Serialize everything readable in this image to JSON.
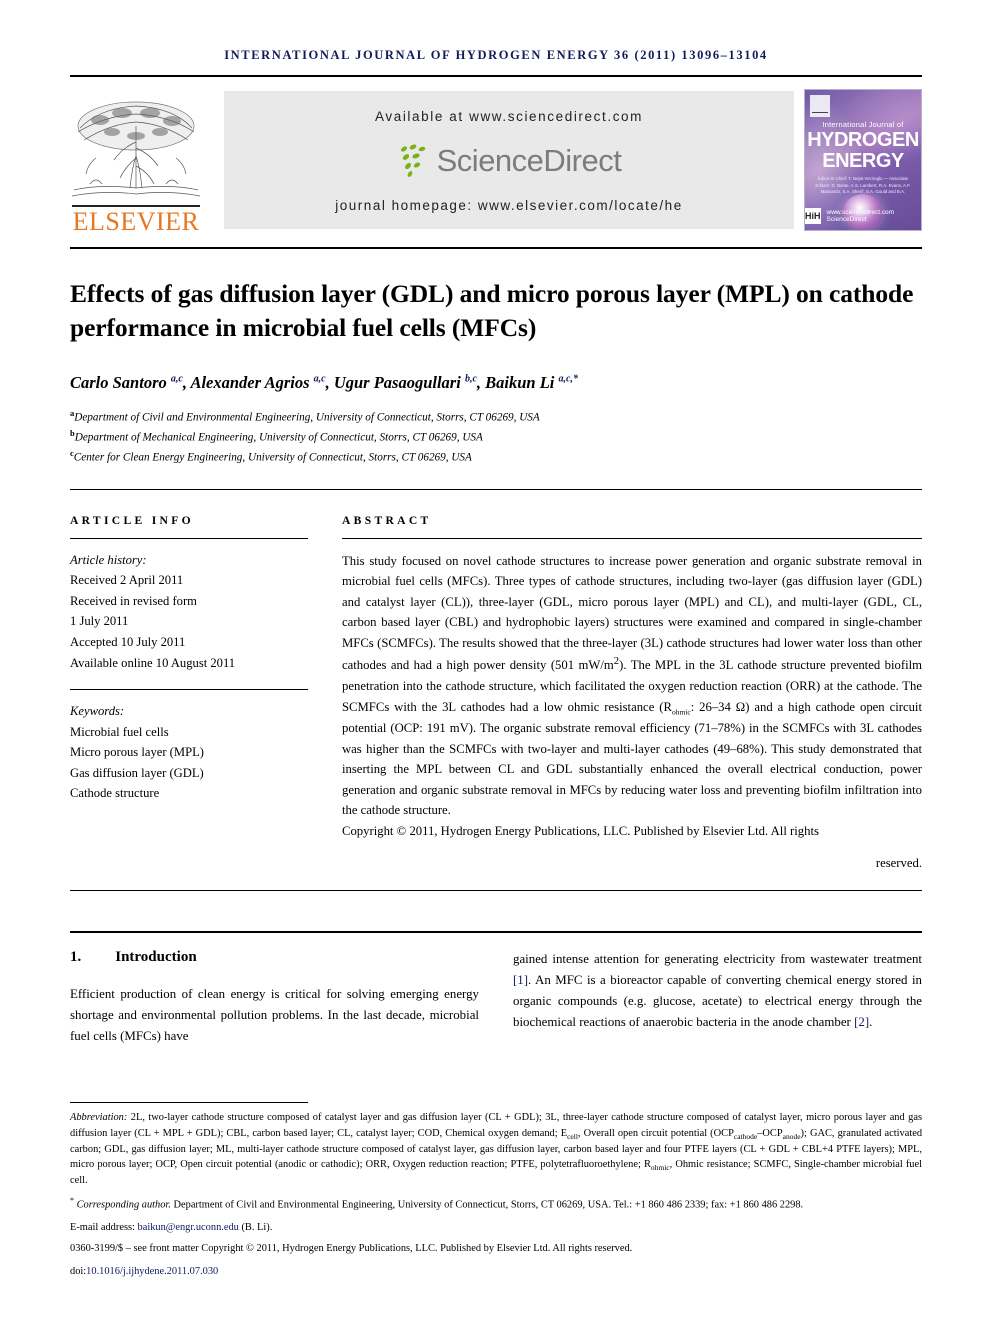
{
  "running_head": "International Journal of Hydrogen Energy 36 (2011) 13096–13104",
  "banner": {
    "publisher": "ELSEVIER",
    "available_at": "Available at www.sciencedirect.com",
    "sciencedirect": "ScienceDirect",
    "journal_homepage": "journal homepage: www.elsevier.com/locate/he",
    "cover": {
      "top_line": "International Journal of",
      "title_line1": "HYDROGEN",
      "title_line2": "ENERGY",
      "editors": "Editor-in-Chief: T. Nejat Veziroglu — Associate Editors: D. Bonte, A.S. Lambert, R.A. Evans, A.F. Massardo, S.A. Sherif, S.A. Gould and B.A. Peterka",
      "badge": "HiH",
      "sciencedirect_mark": "ScienceDirect",
      "sciencedirect_sub": "www.sciencedirect.com"
    }
  },
  "article": {
    "title": "Effects of gas diffusion layer (GDL) and micro porous layer (MPL) on cathode performance in microbial fuel cells (MFCs)",
    "authors_html": "Carlo Santoro <sup>a,c</sup>, Alexander Agrios <sup>a,c</sup>, Ugur Pasaogullari <sup>b,c</sup>, Baikun Li <sup>a,c,*</sup>",
    "affiliations": [
      {
        "marker": "a",
        "text": "Department of Civil and Environmental Engineering, University of Connecticut, Storrs, CT 06269, USA"
      },
      {
        "marker": "b",
        "text": "Department of Mechanical Engineering, University of Connecticut, Storrs, CT 06269, USA"
      },
      {
        "marker": "c",
        "text": "Center for Clean Energy Engineering, University of Connecticut, Storrs, CT 06269, USA"
      }
    ]
  },
  "article_info": {
    "heading": "ARTICLE INFO",
    "history_label": "Article history:",
    "history": [
      "Received 2 April 2011",
      "Received in revised form",
      "1 July 2011",
      "Accepted 10 July 2011",
      "Available online 10 August 2011"
    ],
    "keywords_label": "Keywords:",
    "keywords": [
      "Microbial fuel cells",
      "Micro porous layer (MPL)",
      "Gas diffusion layer (GDL)",
      "Cathode structure"
    ]
  },
  "abstract": {
    "heading": "ABSTRACT",
    "body": "This study focused on novel cathode structures to increase power generation and organic substrate removal in microbial fuel cells (MFCs). Three types of cathode structures, including two-layer (gas diffusion layer (GDL) and catalyst layer (CL)), three-layer (GDL, micro porous layer (MPL) and CL), and multi-layer (GDL, CL, carbon based layer (CBL) and hydrophobic layers) structures were examined and compared in single-chamber MFCs (SCMFCs). The results showed that the three-layer (3L) cathode structures had lower water loss than other cathodes and had a high power density (501 mW/m²). The MPL in the 3L cathode structure prevented biofilm penetration into the cathode structure, which facilitated the oxygen reduction reaction (ORR) at the cathode. The SCMFCs with the 3L cathodes had a low ohmic resistance (Rohmic: 26–34 Ω) and a high cathode open circuit potential (OCP: 191 mV). The organic substrate removal efficiency (71–78%) in the SCMFCs with 3L cathodes was higher than the SCMFCs with two-layer and multi-layer cathodes (49–68%). This study demonstrated that inserting the MPL between CL and GDL substantially enhanced the overall electrical conduction, power generation and organic substrate removal in MFCs by reducing water loss and preventing biofilm infiltration into the cathode structure.",
    "copyright": "Copyright © 2011, Hydrogen Energy Publications, LLC. Published by Elsevier Ltd. All rights",
    "reserved": "reserved."
  },
  "introduction": {
    "number": "1.",
    "heading": "Introduction",
    "left_paragraph": "Efficient production of clean energy is critical for solving emerging energy shortage and environmental pollution problems. In the last decade, microbial fuel cells (MFCs) have",
    "right_paragraph_pre": "gained intense attention for generating electricity from wastewater treatment ",
    "ref1": "[1]",
    "right_paragraph_mid": ". An MFC is a bioreactor capable of converting chemical energy stored in organic compounds (e.g. glucose, acetate) to electrical energy through the biochemical reactions of anaerobic bacteria in the anode chamber ",
    "ref2": "[2]",
    "right_paragraph_end": "."
  },
  "footnotes": {
    "abbreviation_label": "Abbreviation:",
    "abbreviation_text": " 2L, two-layer cathode structure composed of catalyst layer and gas diffusion layer (CL + GDL); 3L, three-layer cathode structure composed of catalyst layer, micro porous layer and gas diffusion layer (CL + MPL + GDL); CBL, carbon based layer; CL, catalyst layer; COD, Chemical oxygen demand; Ecell, Overall open circuit potential (OCPcathode–OCPanode); GAC, granulated activated carbon; GDL, gas diffusion layer; ML, multi-layer cathode structure composed of catalyst layer, gas diffusion layer, carbon based layer and four PTFE layers (CL + GDL + CBL+4 PTFE layers); MPL, micro porous layer; OCP, Open circuit potential (anodic or cathodic); ORR, Oxygen reduction reaction; PTFE, polytetrafluoroethylene; Rohmic, Ohmic resistance; SCMFC, Single-chamber microbial fuel cell.",
    "corresponding_marker": "*",
    "corresponding_label": "Corresponding author.",
    "corresponding_text": " Department of Civil and Environmental Engineering, University of Connecticut, Storrs, CT 06269, USA. Tel.: +1 860 486 2339; fax: +1 860 486 2298.",
    "email_label": "E-mail address:",
    "email": "baikun@engr.uconn.edu",
    "email_suffix": " (B. Li).",
    "issn_line": "0360-3199/$ – see front matter Copyright © 2011, Hydrogen Energy Publications, LLC. Published by Elsevier Ltd. All rights reserved.",
    "doi_label": "doi:",
    "doi": "10.1016/j.ijhydene.2011.07.030"
  }
}
